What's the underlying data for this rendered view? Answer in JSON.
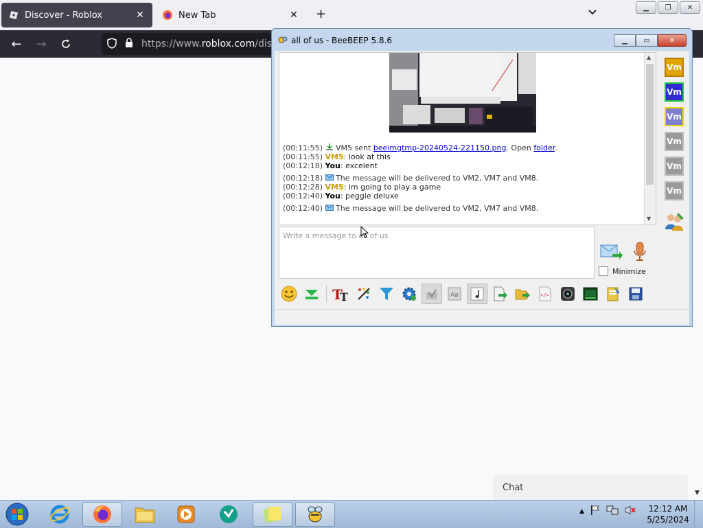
{
  "browser": {
    "tabs": [
      {
        "label": "Discover - Roblox",
        "active": true,
        "icon": "roblox-icon"
      },
      {
        "label": "New Tab",
        "active": false,
        "icon": "firefox-icon"
      }
    ],
    "new_tab_symbol": "+",
    "url_prefix": "https://www.",
    "url_host": "roblox.com",
    "url_rest": "/discover"
  },
  "roblox": {
    "chat_label": "Chat"
  },
  "beebeep": {
    "title": "all of us - BeeBEEP 5.8.6",
    "input_placeholder": "Write a message to all of us",
    "minimize_label": "Minimize",
    "messages": [
      {
        "ts": "(00:11:55)",
        "pre": "VM5 sent ",
        "link": "beeimgtmp-20240524-221150.png",
        "mid": ". Open ",
        "link2": "folder",
        "post": "."
      },
      {
        "ts": "(00:11:55)",
        "user": "VM5",
        "text": ": look at this"
      },
      {
        "ts": "(00:12:18)",
        "user": "You",
        "text": ": excelent"
      },
      {
        "ts": "(00:12:18)",
        "text": "The message will be delivered to VM2, VM7 and VM8."
      },
      {
        "ts": "(00:12:28)",
        "user": "VM5",
        "text": ": im going to play a game"
      },
      {
        "ts": "(00:12:40)",
        "user": "You",
        "text": ": peggle deluxe"
      },
      {
        "ts": "(00:12:40)",
        "text": "The message will be delivered to VM2, VM7 and VM8."
      }
    ],
    "users": [
      {
        "label": "Vm",
        "bg": "#e0a400",
        "border": "#b87a00"
      },
      {
        "label": "Vm",
        "bg": "#2f2bd8",
        "border": "#22c43a"
      },
      {
        "label": "Vm",
        "bg": "#7e7ed0",
        "border": "#e8d800"
      },
      {
        "label": "Vm",
        "bg": "#9a9a9a",
        "border": "#bdbdbd"
      },
      {
        "label": "Vm",
        "bg": "#9a9a9a",
        "border": "#bdbdbd"
      },
      {
        "label": "Vm",
        "bg": "#9a9a9a",
        "border": "#bdbdbd"
      }
    ]
  },
  "taskbar": {
    "time": "12:12 AM",
    "date": "5/25/2024"
  }
}
